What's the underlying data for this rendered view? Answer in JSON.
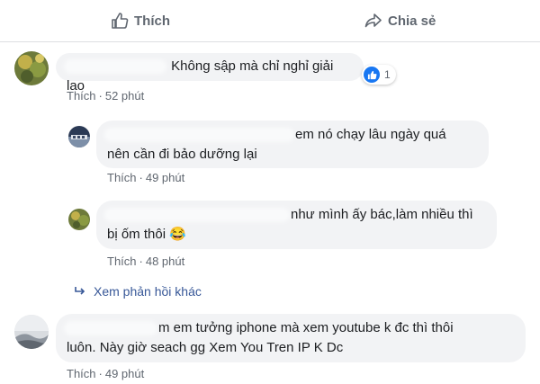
{
  "actions": {
    "like_label": "Thích",
    "share_label": "Chia sẻ"
  },
  "comments": [
    {
      "text": "Không sập mà chỉ nghỉ giải lao",
      "reaction_count": "1",
      "like_label": "Thích",
      "time": "52 phút"
    }
  ],
  "replies": [
    {
      "line1": "em nó chạy lâu ngày quá",
      "line2": "nên cần đi bảo dưỡng lại",
      "like_label": "Thích",
      "time": "49 phút"
    },
    {
      "line1": "như mình ấy bác,làm nhiều thì",
      "line2": "bị ốm thôi 😂",
      "like_label": "Thích",
      "time": "48 phút"
    }
  ],
  "more_replies_label": "Xem phản hồi khác",
  "last_comment": {
    "line1": "m em tưởng iphone mà xem youtube k đc thì thôi",
    "line2": "luôn. Này giờ seach gg Xem You Tren IP K Dc",
    "like_label": "Thích",
    "time": "49 phút"
  },
  "separator": "·",
  "colors": {
    "link": "#385898",
    "meta": "#606770",
    "bubble": "#f2f3f5",
    "reaction_blue": "#1877f2"
  }
}
